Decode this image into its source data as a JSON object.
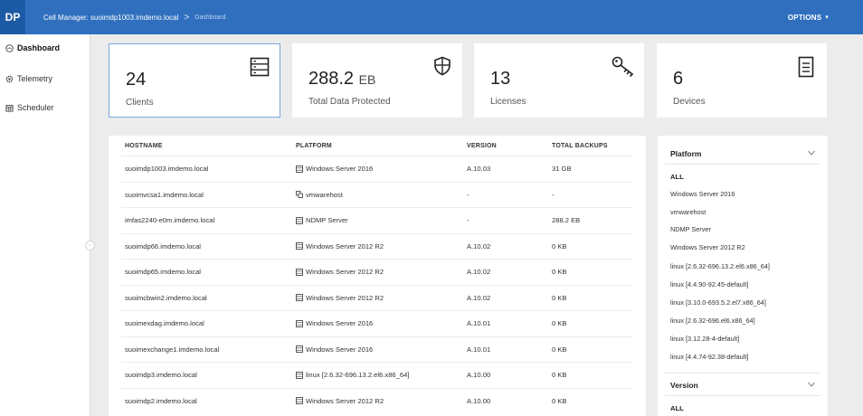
{
  "header": {
    "logo": "DP",
    "breadcrumb_app": "Cell Manager: suoimdp1003.imdemo.local",
    "breadcrumb_sep": ">",
    "breadcrumb_current": "Dashboard",
    "options_label": "OPTIONS",
    "options_caret": "▾"
  },
  "sidebar": {
    "items": [
      {
        "label": "Dashboard",
        "icon": "dashboard-icon",
        "active": true
      },
      {
        "label": "Telemetry",
        "icon": "gear-icon",
        "active": false
      },
      {
        "label": "Scheduler",
        "icon": "calendar-icon",
        "active": false
      }
    ],
    "collapse_glyph": "‹"
  },
  "cards": [
    {
      "value": "24",
      "unit": "",
      "label": "Clients",
      "icon": "server-list-icon"
    },
    {
      "value": "288.2",
      "unit": "EB",
      "label": "Total Data Protected",
      "icon": "shield-icon"
    },
    {
      "value": "13",
      "unit": "",
      "label": "Licenses",
      "icon": "key-icon"
    },
    {
      "value": "6",
      "unit": "",
      "label": "Devices",
      "icon": "device-icon"
    }
  ],
  "table": {
    "headers": [
      "HOSTNAME",
      "PLATFORM",
      "VERSION",
      "TOTAL BACKUPS"
    ],
    "rows": [
      {
        "hostname": "suoimdp1003.imdemo.local",
        "platform": "Windows Server 2016",
        "platform_icon": "windows-server-icon",
        "version": "A.10.03",
        "backups": "31 GB"
      },
      {
        "hostname": "suoimvcsa1.imdemo.local",
        "platform": "vmwarehost",
        "platform_icon": "vmware-icon",
        "version": "-",
        "backups": "-"
      },
      {
        "hostname": "imfas2240-e0m.imdemo.local",
        "platform": "NDMP Server",
        "platform_icon": "windows-server-icon",
        "version": "-",
        "backups": "288.2 EB"
      },
      {
        "hostname": "suoimdp66.imdemo.local",
        "platform": "Windows Server 2012 R2",
        "platform_icon": "windows-server-icon",
        "version": "A.10.02",
        "backups": "0 KB"
      },
      {
        "hostname": "suoimdp65.imdemo.local",
        "platform": "Windows Server 2012 R2",
        "platform_icon": "windows-server-icon",
        "version": "A.10.02",
        "backups": "0 KB"
      },
      {
        "hostname": "suoimcbwin2.imdemo.local",
        "platform": "Windows Server 2012 R2",
        "platform_icon": "windows-server-icon",
        "version": "A.10.02",
        "backups": "0 KB"
      },
      {
        "hostname": "suoimexdag.imdemo.local",
        "platform": "Windows Server 2016",
        "platform_icon": "windows-server-icon",
        "version": "A.10.01",
        "backups": "0 KB"
      },
      {
        "hostname": "suoimexchange1.imdemo.local",
        "platform": "Windows Server 2016",
        "platform_icon": "windows-server-icon",
        "version": "A.10.01",
        "backups": "0 KB"
      },
      {
        "hostname": "suoimdp3.imdemo.local",
        "platform": "linux [2.6.32-696.13.2.el6.x86_64]",
        "platform_icon": "windows-server-icon",
        "version": "A.10.00",
        "backups": "0 KB"
      },
      {
        "hostname": "suoimdp2.imdemo.local",
        "platform": "Windows Server 2012 R2",
        "platform_icon": "windows-server-icon",
        "version": "A.10.00",
        "backups": "0 KB"
      }
    ]
  },
  "filters": {
    "platform": {
      "title": "Platform",
      "items": [
        "ALL",
        "Windows Server 2016",
        "vmwarehost",
        "NDMP Server",
        "Windows Server 2012 R2",
        "linux [2.6.32-696.13.2.el6.x86_64]",
        "linux [4.4.90-92.45-default]",
        "linux [3.10.0-693.5.2.el7.x86_64]",
        "linux [2.6.32-696.el6.x86_64]",
        "linux [3.12.28-4-default]",
        "linux [4.4.74-92.38-default]"
      ]
    },
    "version": {
      "title": "Version",
      "items": [
        "ALL"
      ]
    }
  },
  "colors": {
    "topbar": "#2f6fbe",
    "logo_bg": "#1d5aa5",
    "selected_border": "#7aa7da"
  }
}
